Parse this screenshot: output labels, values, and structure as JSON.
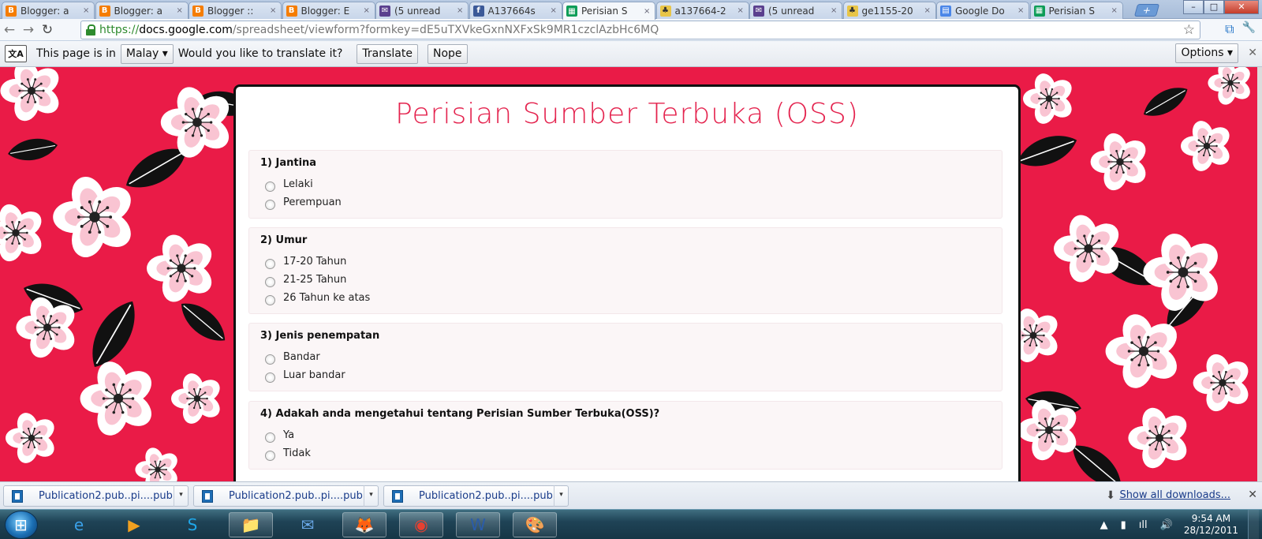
{
  "browser": {
    "tabs": [
      {
        "label": "Blogger: a",
        "favicon": "blogger",
        "active": false
      },
      {
        "label": "Blogger: a",
        "favicon": "blogger",
        "active": false
      },
      {
        "label": "Blogger ::",
        "favicon": "blogger",
        "active": false
      },
      {
        "label": "Blogger: E",
        "favicon": "blogger",
        "active": false
      },
      {
        "label": "(5 unread",
        "favicon": "mail",
        "active": false
      },
      {
        "label": "A137664s",
        "favicon": "facebook",
        "active": false
      },
      {
        "label": "Perisian S",
        "favicon": "sheet",
        "active": true
      },
      {
        "label": "a137664-2",
        "favicon": "people",
        "active": false
      },
      {
        "label": "(5 unread",
        "favicon": "mail",
        "active": false
      },
      {
        "label": "ge1155-20",
        "favicon": "people",
        "active": false
      },
      {
        "label": "Google Do",
        "favicon": "doc",
        "active": false
      },
      {
        "label": "Perisian S",
        "favicon": "sheet",
        "active": false
      }
    ],
    "tab_close_glyph": "×",
    "new_tab_glyph": "+",
    "window_buttons": {
      "minimize": "–",
      "maximize": "□",
      "close": "✕"
    },
    "nav": {
      "back": "←",
      "forward": "→",
      "reload": "↻"
    },
    "url": {
      "scheme": "https://",
      "host": "docs.google.com",
      "path": "/spreadsheet/viewform?formkey=dE5uTXVkeGxnNXFxSk9MR1czclAzbHc6MQ"
    },
    "bookmark_star": "☆",
    "wrench": "🔧"
  },
  "translate_bar": {
    "icon_text": "文A",
    "prefix": "This page is in",
    "language": "Malay",
    "dropdown_arrow": "▾",
    "question": "Would you like to translate it?",
    "translate_button": "Translate",
    "nope_button": "Nope",
    "options_button": "Options",
    "close_glyph": "✕"
  },
  "form": {
    "title": "Perisian Sumber Terbuka (OSS)",
    "questions": [
      {
        "title": "1) Jantina",
        "options": [
          "Lelaki",
          "Perempuan"
        ]
      },
      {
        "title": "2) Umur",
        "options": [
          "17-20 Tahun",
          "21-25 Tahun",
          "26 Tahun ke atas"
        ]
      },
      {
        "title": "3) Jenis penempatan",
        "options": [
          "Bandar",
          "Luar bandar"
        ]
      },
      {
        "title": "4) Adakah anda mengetahui tentang Perisian Sumber Terbuka(OSS)?",
        "options": [
          "Ya",
          "Tidak"
        ]
      }
    ]
  },
  "downloads": {
    "items": [
      "Publication2.pub..pi....pub",
      "Publication2.pub..pi....pub",
      "Publication2.pub..pi....pub"
    ],
    "arrow": "▾",
    "show_all": "Show all downloads...",
    "show_all_icon": "⬇",
    "close_glyph": "✕"
  },
  "taskbar": {
    "apps": [
      "ie-icon",
      "media-player-icon",
      "skype-icon",
      "explorer-icon",
      "thunderbird-icon",
      "firefox-icon",
      "chrome-icon",
      "word-icon",
      "paint-icon"
    ],
    "app_glyphs": [
      "e",
      "▶",
      "S",
      "📁",
      "✉",
      "🦊",
      "◉",
      "W",
      "🎨"
    ],
    "tray_icons": [
      "▲",
      "▮",
      "ıll",
      "🔊"
    ],
    "time": "9:54 AM",
    "date": "28/12/2011"
  },
  "colors": {
    "page_background": "#ea1b47",
    "title_color": "#e4234e",
    "blossom_white": "#ffffff",
    "blossom_pink": "#f9c4d2",
    "leaf_black": "#111111"
  }
}
